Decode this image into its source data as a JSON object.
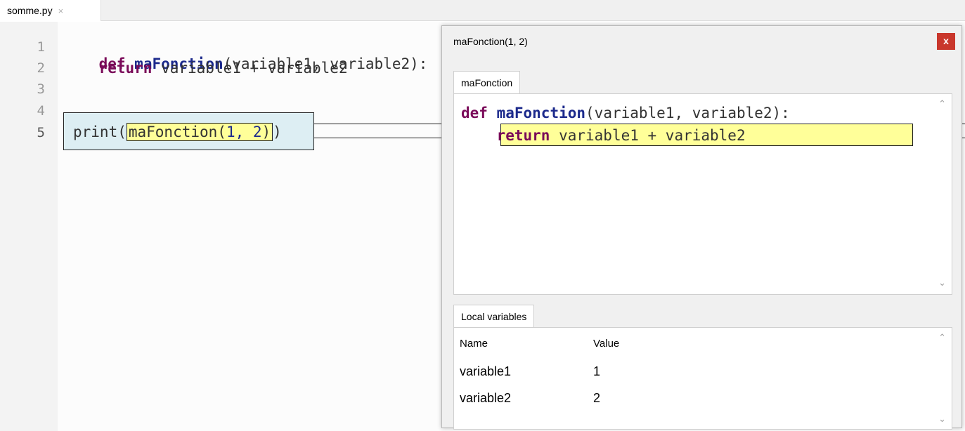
{
  "editor": {
    "tab_label": "somme.py",
    "tab_close": "×",
    "line_numbers": [
      "1",
      "2",
      "3",
      "4",
      "5"
    ],
    "lines": {
      "l1_kw": "def",
      "l1_name": "maFonction",
      "l1_rest": "(variable1, variable2):",
      "l2_kw": "return",
      "l2_rest": " variable1 + variable2",
      "l5_prefix": "print(",
      "l5_call_name": "maFonction(",
      "l5_args": "1, 2",
      "l5_call_close": ")",
      "l5_suffix": ")"
    }
  },
  "popup": {
    "title": "maFonction(1, 2)",
    "close_label": "x",
    "function_tab": "maFonction",
    "code": {
      "l1_kw": "def",
      "l1_name": "maFonction",
      "l1_rest": "(variable1, variable2):",
      "l2_kw": "return",
      "l2_rest": " variable1 + variable2"
    },
    "locals_tab": "Local variables",
    "locals_headers": {
      "name": "Name",
      "value": "Value"
    },
    "locals_rows": [
      {
        "name": "variable1",
        "value": "1"
      },
      {
        "name": "variable2",
        "value": "2"
      }
    ],
    "scroll_up": "⌃",
    "scroll_down": "⌄"
  },
  "colors": {
    "keyword": "#7a0a59",
    "function_name": "#1c2a8c",
    "highlight": "#ffff99",
    "call_box": "#ddeef3",
    "close_button": "#c9372c"
  }
}
